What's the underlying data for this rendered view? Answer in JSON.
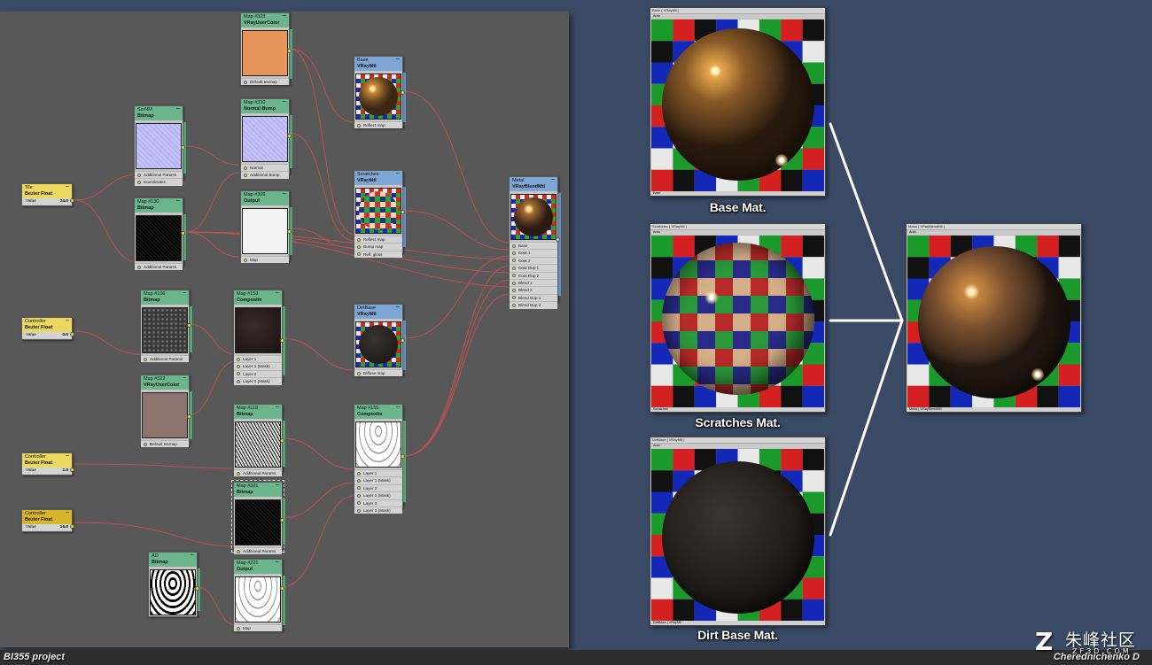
{
  "project_label": "BI355 project",
  "author_label": "Cherednichenko D",
  "watermark": {
    "brand": "朱峰社区",
    "domain": "ZF3D.COM",
    "logo": "Z"
  },
  "colors": {
    "slate": "#585858",
    "background": "#3a4a65",
    "wire": "#c0504d",
    "slot_active": "#e7e323",
    "header_map": "#6bb58c",
    "header_material": "#7ea6d4",
    "header_controller": "#ecd760"
  },
  "nodes": {
    "tile": {
      "title": "Tile",
      "type": "Bezier Float",
      "value_label": "Value",
      "value": "24.0"
    },
    "ctrl1": {
      "title": "Controller",
      "type": "Bezier Float",
      "value_label": "Value",
      "value": "0.0"
    },
    "ctrl2": {
      "title": "Controller",
      "type": "Bezier Float",
      "value_label": "Value",
      "value": "2.0"
    },
    "ctrl3": {
      "title": "Controller",
      "type": "Bezier Float",
      "value_label": "Value",
      "value": "16.0"
    },
    "scrnm": {
      "title": "ScrNM",
      "type": "Bitmap",
      "slots": [
        "Additional Params",
        "Coordinates"
      ]
    },
    "map130": {
      "title": "Map #130",
      "type": "Bitmap",
      "slots": [
        "Additional Params"
      ]
    },
    "map323": {
      "title": "Map #323",
      "type": "VRayUserColor",
      "slots": [
        "Default texmap"
      ]
    },
    "map310": {
      "title": "Map #310",
      "type": "Normal Bump",
      "slots": [
        "Normal",
        "Additional Bump"
      ]
    },
    "map309": {
      "title": "Map #309",
      "type": "Output",
      "slots": [
        "Map"
      ]
    },
    "map106": {
      "title": "Map #106",
      "type": "Bitmap",
      "slots": [
        "Additional Params"
      ]
    },
    "map322": {
      "title": "Map #322",
      "type": "VRayUserColor",
      "slots": [
        "Default texmap"
      ]
    },
    "map153": {
      "title": "Map #153",
      "type": "Composite",
      "slots": [
        "Layer 1",
        "Layer 1 (Mask)",
        "Layer 2",
        "Layer 2 (Mask)"
      ]
    },
    "map118": {
      "title": "Map #118",
      "type": "Bitmap",
      "slots": [
        "Additional Params"
      ]
    },
    "map321": {
      "title": "Map #321",
      "type": "Bitmap",
      "slots": [
        "Additional Params"
      ]
    },
    "ao": {
      "title": "AO",
      "type": "Bitmap",
      "slots": []
    },
    "map221": {
      "title": "Map #221",
      "type": "Output",
      "slots": [
        "Map"
      ]
    },
    "map155": {
      "title": "Map #155",
      "type": "Composite",
      "slots": [
        "Layer 1",
        "Layer 1 (Mask)",
        "Layer 2",
        "Layer 2 (Mask)",
        "Layer 3",
        "Layer 3 (Mask)"
      ]
    },
    "base": {
      "title": "Base",
      "type": "VRayMtl",
      "slots": [
        "Reflect map"
      ]
    },
    "scratches": {
      "title": "Scratches",
      "type": "VRayMtl",
      "slots": [
        "Reflect map",
        "Bump map",
        "Refl. gloss"
      ]
    },
    "dirtbase": {
      "title": "DirtBase",
      "type": "VRayMtl",
      "slots": [
        "Diffuse map"
      ]
    },
    "metal": {
      "title": "Metal",
      "type": "VRayBlendMtl",
      "slots": [
        "Base",
        "Coat 1",
        "Coat 2",
        "Coat Dup 1",
        "Coat Dup 2",
        "Blend 1",
        "Blend 2",
        "Blend Dup 1",
        "Blend Dup 2"
      ]
    }
  },
  "previews": {
    "base": {
      "window_title": "Base ( VRayMtl )",
      "toolbar": "Auto",
      "footer": "Base",
      "caption": "Base Mat."
    },
    "scratches": {
      "window_title": "Scratches ( VRayMtl )",
      "toolbar": "Auto",
      "footer": "Scratches",
      "caption": "Scratches Mat."
    },
    "dirt": {
      "window_title": "DirtBase ( VRayMtl )",
      "toolbar": "Auto",
      "footer": "DirtBase | VRayMtl",
      "caption": "Dirt Base Mat."
    },
    "metal": {
      "window_title": "Metal ( VRayBlendMtl )",
      "toolbar": "Auto",
      "footer": "Metal | VRayBlendMtl",
      "caption": ""
    }
  }
}
